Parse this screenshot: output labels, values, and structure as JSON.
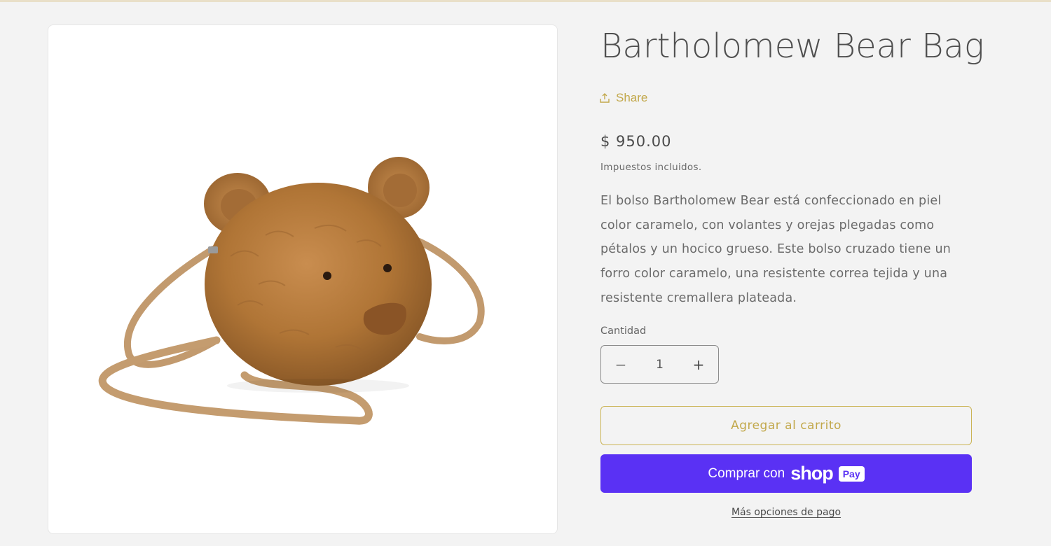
{
  "product": {
    "title": "Bartholomew Bear Bag",
    "image_alt": "Bartholomew Bear Bag",
    "share_label": "Share",
    "price": "$ 950.00",
    "tax_note": "Impuestos incluidos.",
    "description": "El bolso Bartholomew Bear está confeccionado en piel color caramelo, con volantes y orejas plegadas como pétalos y un hocico grueso. Este bolso cruzado tiene un forro color caramelo, una resistente correa tejida y una resistente cremallera plateada."
  },
  "quantity": {
    "label": "Cantidad",
    "value": "1",
    "decrease_symbol": "−",
    "increase_symbol": "+"
  },
  "actions": {
    "add_to_cart": "Agregar al carrito",
    "shop_pay_prefix": "Comprar con",
    "shop_pay_brand": "shop",
    "shop_pay_badge": "Pay",
    "more_payment_options": "Más opciones de pago"
  },
  "colors": {
    "accent_gold": "#c2a84b",
    "shop_pay_purple": "#5a31f4",
    "background": "#f3f3f3"
  },
  "icons": {
    "share": "share-icon"
  }
}
